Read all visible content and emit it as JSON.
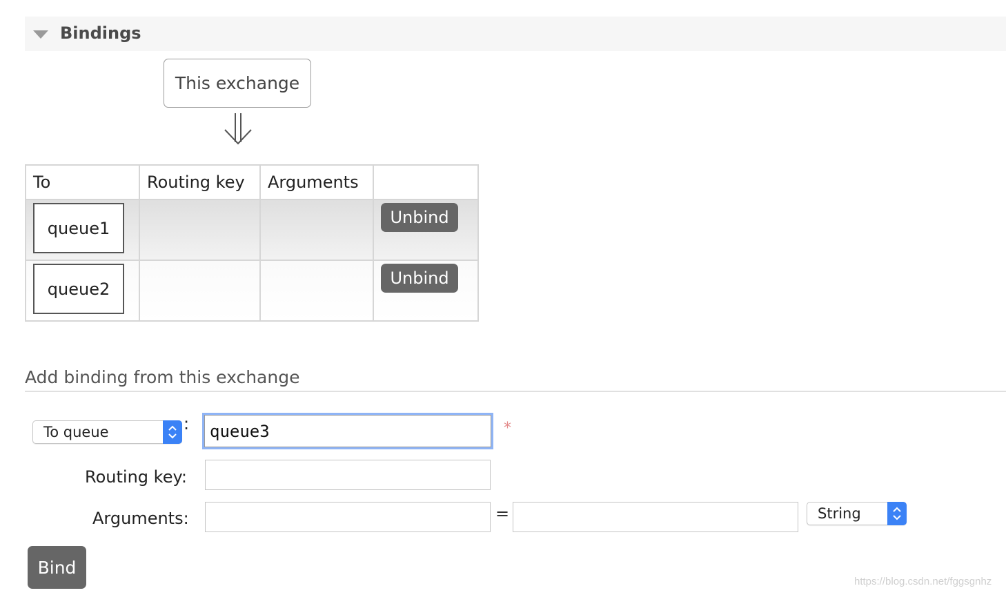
{
  "section": {
    "title": "Bindings",
    "exchange_label": "This exchange"
  },
  "table": {
    "headers": [
      "To",
      "Routing key",
      "Arguments",
      ""
    ],
    "rows": [
      {
        "to": "queue1",
        "routing_key": "",
        "arguments": "",
        "action": "Unbind"
      },
      {
        "to": "queue2",
        "routing_key": "",
        "arguments": "",
        "action": "Unbind"
      }
    ]
  },
  "add_binding": {
    "title": "Add binding from this exchange",
    "destination_type": "To queue",
    "separator": ":",
    "destination_value": "queue3",
    "required_marker": "*",
    "routing_key_label": "Routing key:",
    "routing_key_value": "",
    "arguments_label": "Arguments:",
    "argument_key": "",
    "equals": "=",
    "argument_value": "",
    "argument_type": "String",
    "bind_label": "Bind"
  },
  "watermark": "https://blog.csdn.net/fggsgnhz",
  "colors": {
    "button_bg": "#666666",
    "select_accent": "#3b82f6",
    "focus_ring": "#8fb4f5",
    "required": "#e38b8b",
    "header_bg": "#f6f6f6"
  }
}
